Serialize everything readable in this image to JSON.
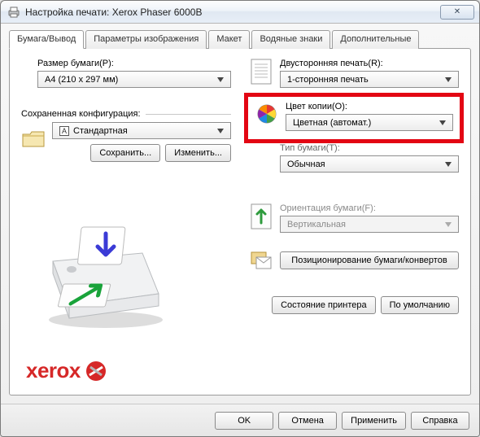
{
  "window": {
    "title": "Настройка печати: Xerox Phaser 6000B",
    "close_glyph": "✕"
  },
  "tabs": [
    {
      "label": "Бумага/Вывод"
    },
    {
      "label": "Параметры изображения"
    },
    {
      "label": "Макет"
    },
    {
      "label": "Водяные знаки"
    },
    {
      "label": "Дополнительные"
    }
  ],
  "left": {
    "paper_size_label": "Размер бумаги(P):",
    "paper_size_value": "A4 (210 x 297 мм)",
    "saved_config_label": "Сохраненная конфигурация:",
    "saved_config_value": "Стандартная",
    "save_button": "Сохранить...",
    "edit_button": "Изменить..."
  },
  "right": {
    "duplex_label": "Двусторонняя печать(R):",
    "duplex_value": "1-сторонняя печать",
    "color_label": "Цвет копии(O):",
    "color_value": "Цветная (автомат.)",
    "paper_type_label": "Тип бумаги(T):",
    "paper_type_value": "Обычная",
    "orientation_label": "Ориентация бумаги(F):",
    "orientation_value": "Вертикальная",
    "envelope_button": "Позиционирование бумаги/конвертов",
    "printer_status_button": "Состояние принтера",
    "defaults_button": "По умолчанию"
  },
  "logo": "xerox",
  "footer": {
    "ok": "OK",
    "cancel": "Отмена",
    "apply": "Применить",
    "help": "Справка"
  }
}
